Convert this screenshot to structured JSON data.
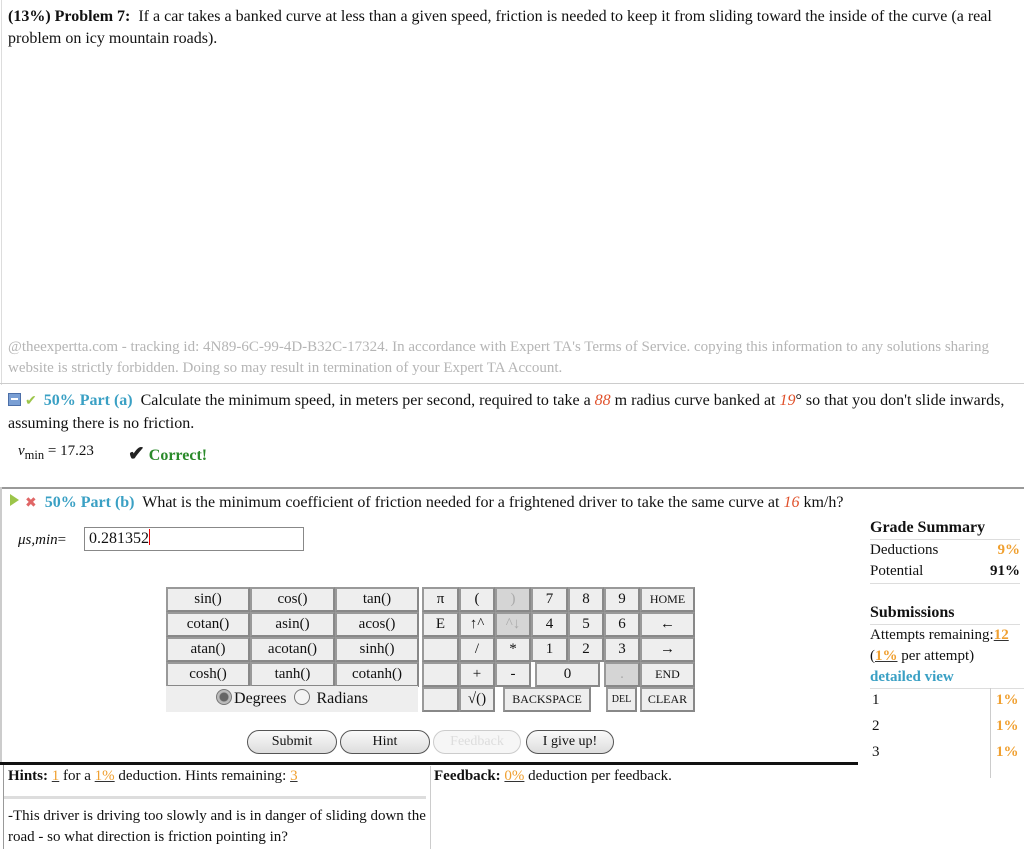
{
  "problem": {
    "weight": "(13%)",
    "label": "Problem 7:",
    "text": "If a car takes a banked curve at less than a given speed, friction is needed to keep it from sliding toward the inside of the curve (a real problem on icy mountain roads)."
  },
  "tracking": "@theexpertta.com - tracking id: 4N89-6C-99-4D-B32C-17324. In accordance with Expert TA's Terms of Service. copying this information to any solutions sharing website is strictly forbidden. Doing so may result in termination of your Expert TA Account.",
  "part_a": {
    "weight": "50%",
    "label": "Part (a)",
    "text_1": "Calculate the minimum speed, in meters per second, required to take a",
    "radius": "88",
    "text_2": "m radius curve banked at",
    "angle": "19",
    "text_3": "° so that you don't slide inwards, assuming there is no friction.",
    "var_symbol": "v",
    "var_sub": "min",
    "answer": "= 17.23",
    "status": "Correct!"
  },
  "part_b": {
    "weight": "50%",
    "label": "Part (b)",
    "text_1": "What is the minimum coefficient of friction needed for a frightened driver to take the same curve at",
    "speed": "16",
    "text_2": "km/h?",
    "var_label": "μs,min",
    "equals": "=",
    "input_value": "0.281352"
  },
  "keypad": {
    "functions": [
      [
        "sin()",
        "cos()",
        "tan()"
      ],
      [
        "cotan()",
        "asin()",
        "acos()"
      ],
      [
        "atan()",
        "acotan()",
        "sinh()"
      ],
      [
        "cosh()",
        "tanh()",
        "cotanh()"
      ]
    ],
    "degrees": "Degrees",
    "radians": "Radians",
    "keys": {
      "pi": "π",
      "e": "E",
      "lparen": "(",
      "rparen": ")",
      "up": "↑^",
      "down": "^↓",
      "div": "/",
      "mul": "*",
      "plus": "+",
      "minus": "-",
      "sqrt": "√()",
      "n7": "7",
      "n8": "8",
      "n9": "9",
      "n4": "4",
      "n5": "5",
      "n6": "6",
      "n1": "1",
      "n2": "2",
      "n3": "3",
      "n0": "0",
      "dot": ".",
      "home": "HOME",
      "left": "←",
      "right": "→",
      "end": "END",
      "backspace": "BACKSPACE",
      "del": "DEL",
      "clear": "CLEAR"
    }
  },
  "buttons": {
    "submit": "Submit",
    "hint": "Hint",
    "feedback": "Feedback",
    "giveup": "I give up!"
  },
  "grade_summary": {
    "title": "Grade Summary",
    "deductions_label": "Deductions",
    "deductions_value": "9%",
    "potential_label": "Potential",
    "potential_value": "91%"
  },
  "submissions": {
    "title": "Submissions",
    "attempts_label": "Attempts remaining:",
    "attempts_value": "12",
    "per_attempt_pct": "1%",
    "per_attempt_text": "per attempt)",
    "detailed_view": "detailed view",
    "rows": [
      {
        "n": "1",
        "v": "1%"
      },
      {
        "n": "2",
        "v": "1%"
      },
      {
        "n": "3",
        "v": "1%"
      }
    ]
  },
  "hints": {
    "label": "Hints:",
    "count": "1",
    "for_a": "for a",
    "pct": "1%",
    "deduction": "deduction. Hints remaining:",
    "remaining": "3",
    "text": "-This driver is driving too slowly and is in danger of sliding down the road - so what direction is friction pointing in?"
  },
  "feedback": {
    "label": "Feedback:",
    "pct": "0%",
    "text": "deduction per feedback."
  }
}
